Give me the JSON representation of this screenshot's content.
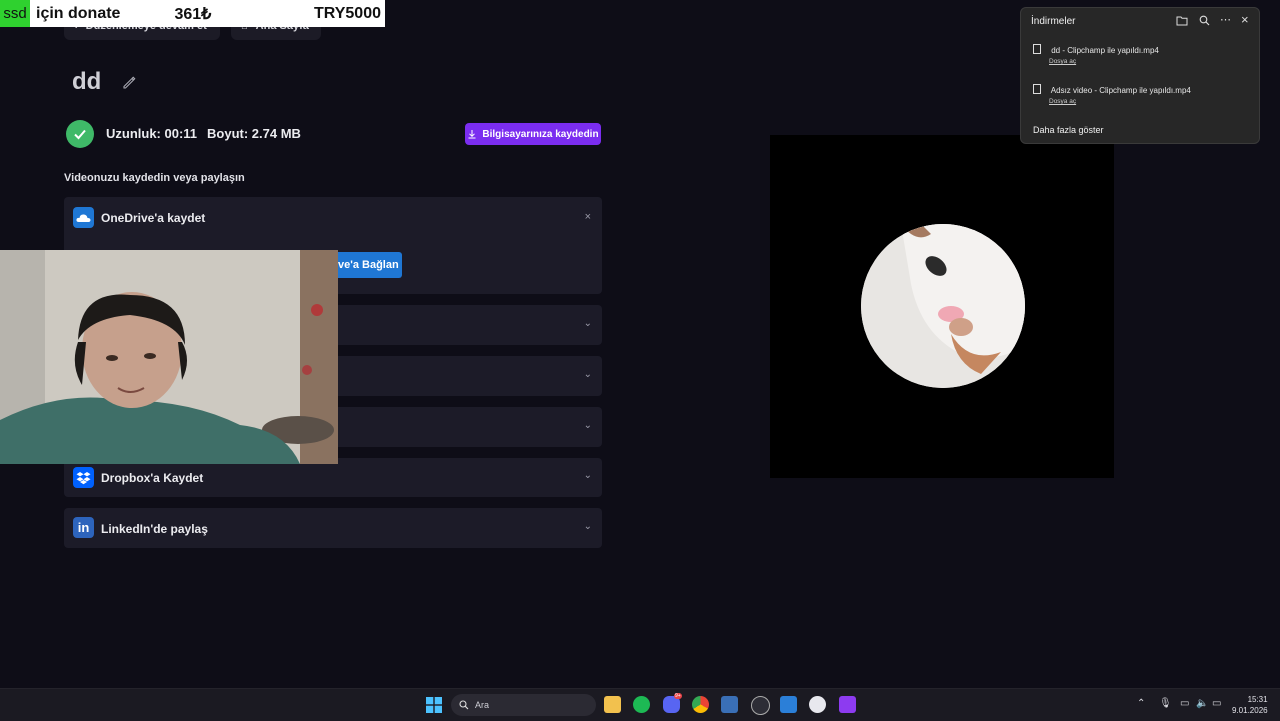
{
  "nav": {
    "back_label": "Düzenlemeye devam et",
    "home_label": "Ana Sayfa"
  },
  "donation": {
    "tag": "ssd",
    "text": "için donate",
    "amount": "361₺",
    "goal": "TRY5000"
  },
  "project": {
    "title": "dd",
    "duration": "Uzunluk: 00:11",
    "size": "Boyut: 2.74 MB",
    "save_button": "Bilgisayarınıza kaydedin"
  },
  "share": {
    "heading": "Videonuzu kaydedin veya paylaşın",
    "onedrive_label": "OneDrive'a kaydet",
    "onedrive_connect": "ve'a Bağlan",
    "dropbox_label": "Dropbox'a Kaydet",
    "linkedin_label": "LinkedIn'de paylaş"
  },
  "downloads": {
    "title": "İndirmeler",
    "items": [
      {
        "name": "dd - Clipchamp ile yapıldı.mp4",
        "action": "Dosya aç"
      },
      {
        "name": "Adsız video - Clipchamp ile yapıldı.mp4",
        "action": "Dosya aç"
      }
    ],
    "more": "Daha fazla göster"
  },
  "taskbar": {
    "search_placeholder": "Ara",
    "time": "15:31",
    "date": "9.01.2026",
    "discord_badge": "9+"
  },
  "colors": {
    "accent": "#7b2df0",
    "success": "#3fb968",
    "onedrive": "#1f77d4",
    "background": "#0e0d17",
    "card": "#1c1b28"
  }
}
